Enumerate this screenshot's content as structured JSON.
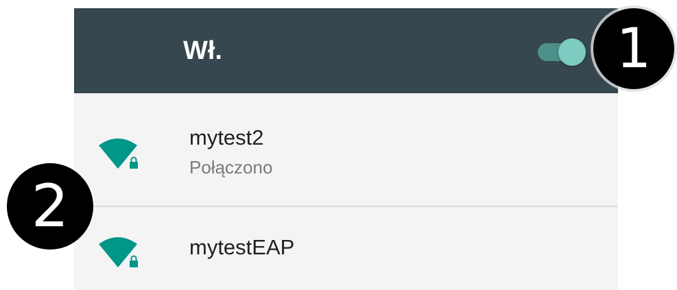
{
  "header": {
    "title": "Wł.",
    "toggle_on": true,
    "colors": {
      "background": "#37474f",
      "toggle_track": "#4d8f89",
      "toggle_thumb": "#7ecbc1"
    }
  },
  "networks": [
    {
      "name": "mytest2",
      "status": "Połączono",
      "icon": "wifi-locked-icon"
    },
    {
      "name": "mytestEAP",
      "icon": "wifi-locked-icon"
    }
  ],
  "callouts": {
    "first": "1",
    "second": "2"
  },
  "accent_color": "#009688"
}
